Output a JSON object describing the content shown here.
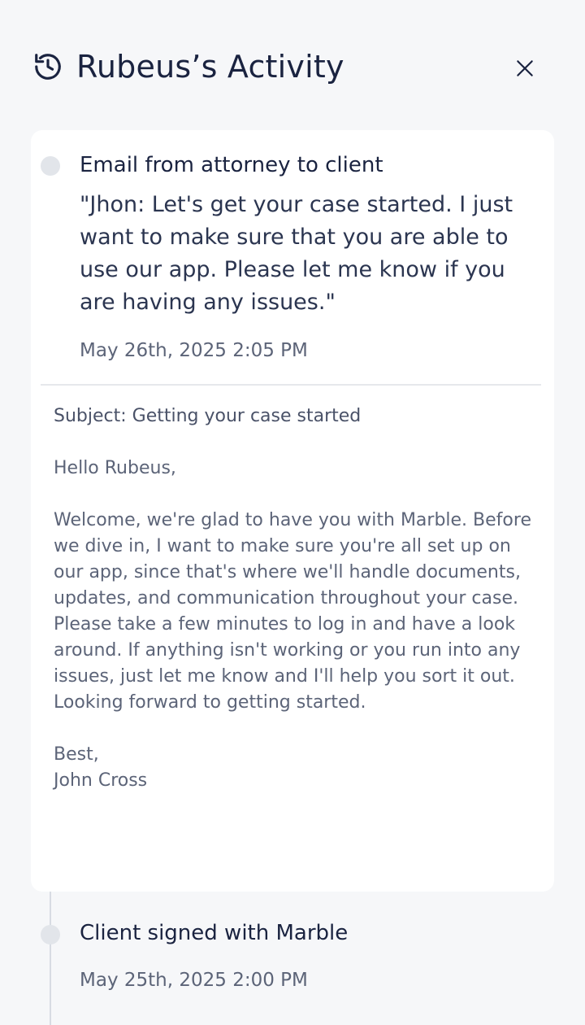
{
  "header": {
    "title": "Rubeus’s Activity",
    "history_icon": "history-icon",
    "close_icon": "close-icon"
  },
  "activities": [
    {
      "title": "Email from attorney to client",
      "quote": "\"Jhon: Let's get your case started. I just want to make sure that you are able to use our app. Please let me know if you are having any issues.\"",
      "timestamp": "May 26th, 2025 2:05 PM",
      "email": {
        "subject": "Subject: Getting your case started",
        "greeting": "Hello Rubeus,",
        "body": "Welcome, we're glad to have you with Marble. Before we dive in, I want to make sure you're all set up on our app, since that's where we'll handle documents, updates, and communication throughout your case. Please take a few minutes to log in and have a look around. If anything isn't working or you run into any issues, just let me know and I'll help you sort it out. Looking forward to getting started.",
        "signoff": "Best,",
        "signature": "John Cross"
      }
    },
    {
      "title": "Client signed with Marble",
      "timestamp": "May 25th, 2025 2:00 PM"
    }
  ],
  "colors": {
    "background": "#f6f7f9",
    "card": "#ffffff",
    "title_text": "#1a2340",
    "muted_text": "#5c6478",
    "dot": "#e2e5ea",
    "line": "#d8dce3"
  }
}
